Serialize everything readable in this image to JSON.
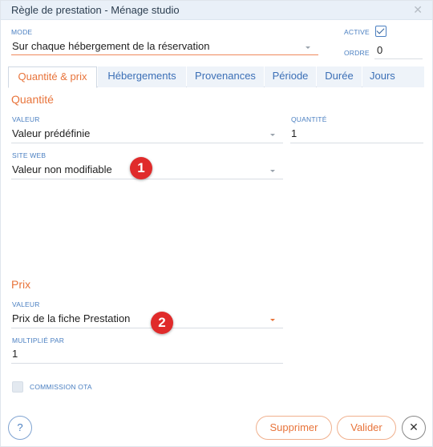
{
  "window": {
    "title": "Règle de prestation - Ménage studio",
    "close_icon": "close-icon"
  },
  "mode": {
    "label": "MODE",
    "value": "Sur chaque hébergement de la réservation"
  },
  "active": {
    "label": "ACTIVE",
    "checked": true
  },
  "ordre": {
    "label": "ORDRE",
    "value": "0"
  },
  "tabs": [
    {
      "label": "Quantité & prix",
      "active": true
    },
    {
      "label": "Hébergements"
    },
    {
      "label": "Provenances"
    },
    {
      "label": "Période"
    },
    {
      "label": "Durée"
    },
    {
      "label": "Jours"
    }
  ],
  "quantite_section": {
    "title": "Quantité",
    "valeur_label": "VALEUR",
    "valeur_value": "Valeur prédéfinie",
    "quantite_label": "QUANTITÉ",
    "quantite_value": "1",
    "site_web_label": "SITE WEB",
    "site_web_value": "Valeur non modifiable"
  },
  "prix_section": {
    "title": "Prix",
    "valeur_label": "VALEUR",
    "valeur_value": "Prix de la fiche Prestation",
    "multiplie_label": "MULTIPLIÉ PAR",
    "multiplie_value": "1",
    "commission_label": "COMMISSION OTA"
  },
  "badges": [
    "1",
    "2"
  ],
  "footer": {
    "help_label": "?",
    "supprimer_label": "Supprimer",
    "valider_label": "Valider",
    "close_label": "✕"
  },
  "colors": {
    "accent_orange": "#e8743b",
    "accent_blue": "#4a7fc1",
    "badge_red": "#e02b2b"
  }
}
